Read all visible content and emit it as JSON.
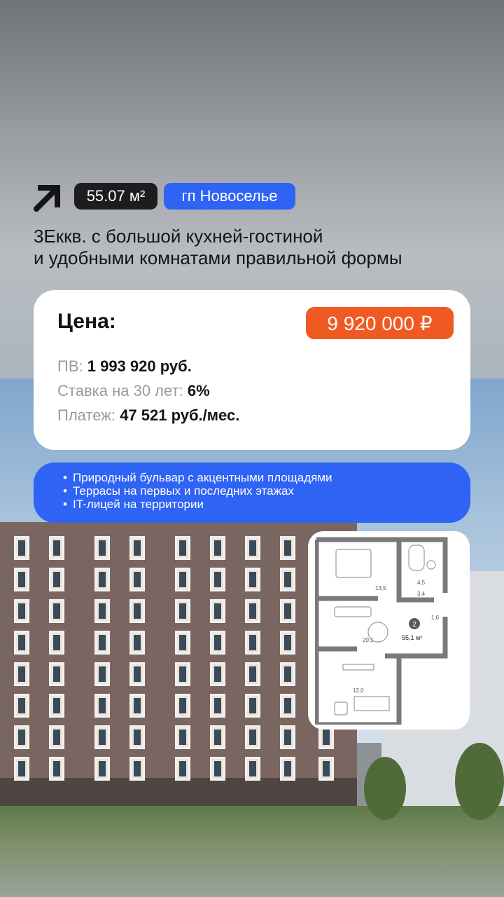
{
  "badges": {
    "area": "55.07 м²",
    "location": "гп Новоселье"
  },
  "headline": {
    "line1": "3Еккв. с большой кухней-гостиной",
    "line2": "и удобными комнатами правильной формы"
  },
  "price_card": {
    "label": "Цена:",
    "price": "9 920 000 ₽",
    "down_payment_label": "ПВ:",
    "down_payment_value": "1 993 920 руб.",
    "rate_label": "Ставка на 30 лет:",
    "rate_value": "6%",
    "payment_label": "Платеж:",
    "payment_value": "47 521 руб./мес."
  },
  "features": [
    "Природный бульвар с акцентными площадями",
    "Террасы на первых и последних этажах",
    "IT-лицей на территории"
  ],
  "floor_plan": {
    "rooms": {
      "r1": "13,5",
      "r2": "4,5",
      "r3": "3,4",
      "r4": "1,6",
      "r5": "20,1",
      "r6": "12,0"
    },
    "apt_number": "2",
    "total_area": "55,1 м²"
  },
  "colors": {
    "accent_blue": "#2f63f5",
    "accent_orange": "#f05a22",
    "dark": "#1d1d1f"
  }
}
